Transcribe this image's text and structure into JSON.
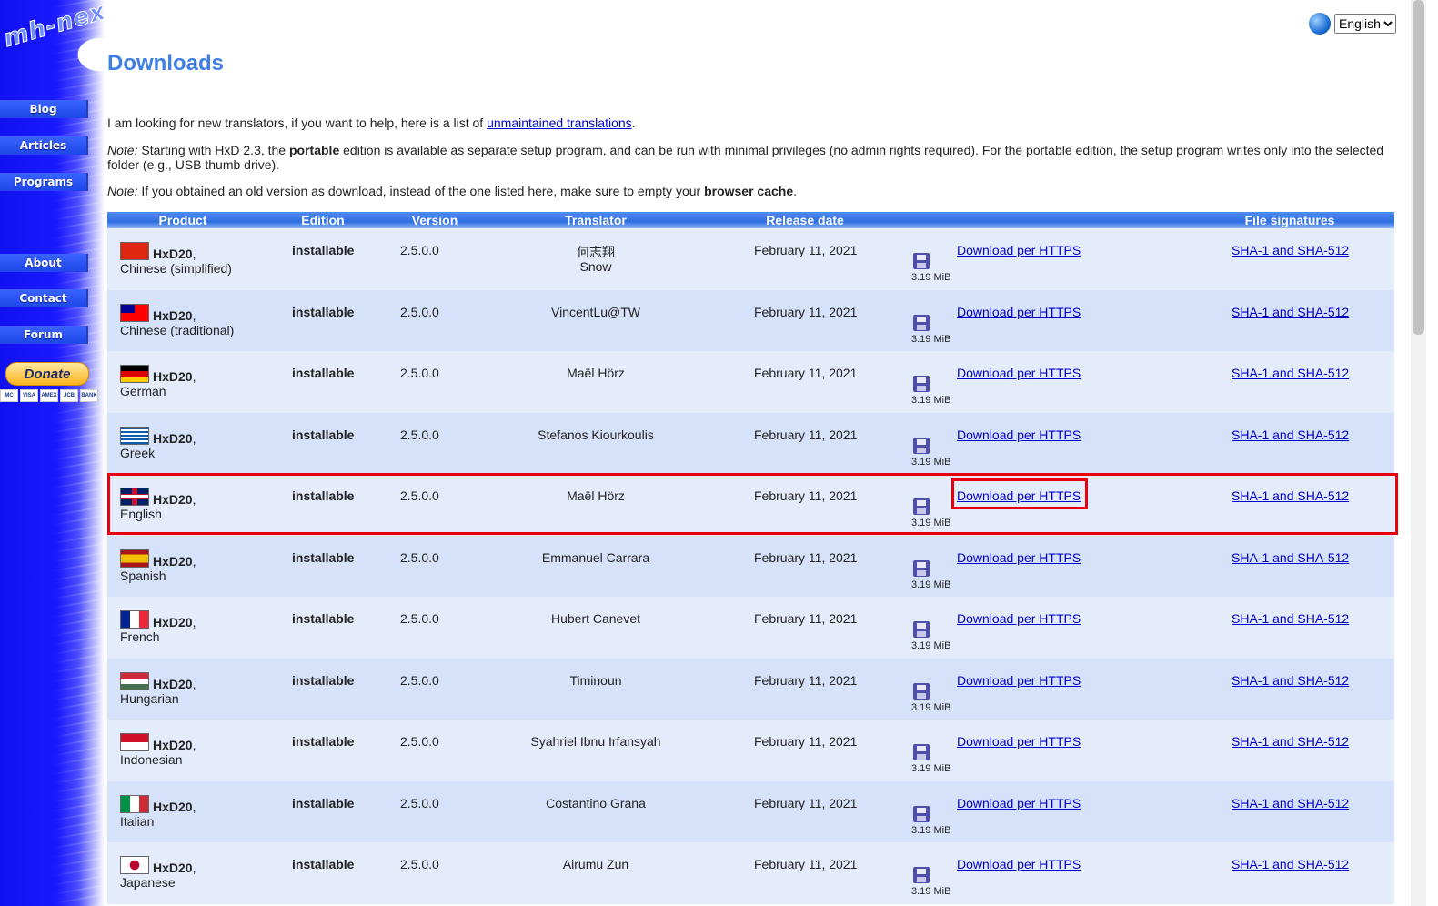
{
  "sidebar": {
    "logo": "mh-nexus",
    "nav": [
      "Blog",
      "Articles",
      "Programs",
      "About",
      "Contact",
      "Forum"
    ],
    "donate_label": "Donate",
    "cards": [
      "MC",
      "VISA",
      "AMEX",
      "JCB",
      "BANK"
    ]
  },
  "language": {
    "selected": "English"
  },
  "page": {
    "title": "Downloads",
    "intro_text": "I am looking for new translators, if you want to help, here is a list of ",
    "intro_link": "unmaintained translations",
    "intro_end": ".",
    "note_label": "Note:",
    "note1_a": " Starting with HxD 2.3, the ",
    "note1_bold": "portable",
    "note1_b": " edition is available as separate setup program, and can be run with minimal privileges (no admin rights required). For the portable edition, the setup program writes only into the selected folder (e.g., USB thumb drive).",
    "note2_a": " If you obtained an old version as download, instead of the one listed here, make sure to empty your ",
    "note2_bold": "browser cache",
    "note2_b": "."
  },
  "table": {
    "headers": [
      "Product",
      "Edition",
      "Version",
      "Translator",
      "Release date",
      "File signatures"
    ],
    "rows": [
      {
        "product": "HxD20",
        "language": "Chinese (simplified)",
        "edition": "installable",
        "version": "2.5.0.0",
        "translator": "何志翔\nSnow",
        "date": "February 11, 2021",
        "size": "3.19 MiB",
        "download": "Download per HTTPS",
        "sig": "SHA-1 and SHA-512",
        "flag": "cn"
      },
      {
        "product": "HxD20",
        "language": "Chinese (traditional)",
        "edition": "installable",
        "version": "2.5.0.0",
        "translator": "VincentLu@TW",
        "date": "February 11, 2021",
        "size": "3.19 MiB",
        "download": "Download per HTTPS",
        "sig": "SHA-1 and SHA-512",
        "flag": "tw"
      },
      {
        "product": "HxD20",
        "language": "German",
        "edition": "installable",
        "version": "2.5.0.0",
        "translator": "Maël Hörz",
        "date": "February 11, 2021",
        "size": "3.19 MiB",
        "download": "Download per HTTPS",
        "sig": "SHA-1 and SHA-512",
        "flag": "de"
      },
      {
        "product": "HxD20",
        "language": "Greek",
        "edition": "installable",
        "version": "2.5.0.0",
        "translator": "Stefanos Kiourkoulis",
        "date": "February 11, 2021",
        "size": "3.19 MiB",
        "download": "Download per HTTPS",
        "sig": "SHA-1 and SHA-512",
        "flag": "gr"
      },
      {
        "product": "HxD20",
        "language": "English",
        "edition": "installable",
        "version": "2.5.0.0",
        "translator": "Maël Hörz",
        "date": "February 11, 2021",
        "size": "3.19 MiB",
        "download": "Download per HTTPS",
        "sig": "SHA-1 and SHA-512",
        "flag": "gb"
      },
      {
        "product": "HxD20",
        "language": "Spanish",
        "edition": "installable",
        "version": "2.5.0.0",
        "translator": "Emmanuel Carrara",
        "date": "February 11, 2021",
        "size": "3.19 MiB",
        "download": "Download per HTTPS",
        "sig": "SHA-1 and SHA-512",
        "flag": "es"
      },
      {
        "product": "HxD20",
        "language": "French",
        "edition": "installable",
        "version": "2.5.0.0",
        "translator": "Hubert Canevet",
        "date": "February 11, 2021",
        "size": "3.19 MiB",
        "download": "Download per HTTPS",
        "sig": "SHA-1 and SHA-512",
        "flag": "fr"
      },
      {
        "product": "HxD20",
        "language": "Hungarian",
        "edition": "installable",
        "version": "2.5.0.0",
        "translator": "Timinoun",
        "date": "February 11, 2021",
        "size": "3.19 MiB",
        "download": "Download per HTTPS",
        "sig": "SHA-1 and SHA-512",
        "flag": "hu"
      },
      {
        "product": "HxD20",
        "language": "Indonesian",
        "edition": "installable",
        "version": "2.5.0.0",
        "translator": "Syahriel Ibnu Irfansyah",
        "date": "February 11, 2021",
        "size": "3.19 MiB",
        "download": "Download per HTTPS",
        "sig": "SHA-1 and SHA-512",
        "flag": "id"
      },
      {
        "product": "HxD20",
        "language": "Italian",
        "edition": "installable",
        "version": "2.5.0.0",
        "translator": "Costantino Grana",
        "date": "February 11, 2021",
        "size": "3.19 MiB",
        "download": "Download per HTTPS",
        "sig": "SHA-1 and SHA-512",
        "flag": "it"
      },
      {
        "product": "HxD20",
        "language": "Japanese",
        "edition": "installable",
        "version": "2.5.0.0",
        "translator": "Airumu Zun",
        "date": "February 11, 2021",
        "size": "3.19 MiB",
        "download": "Download per HTTPS",
        "sig": "SHA-1 and SHA-512",
        "flag": "jp"
      }
    ]
  }
}
